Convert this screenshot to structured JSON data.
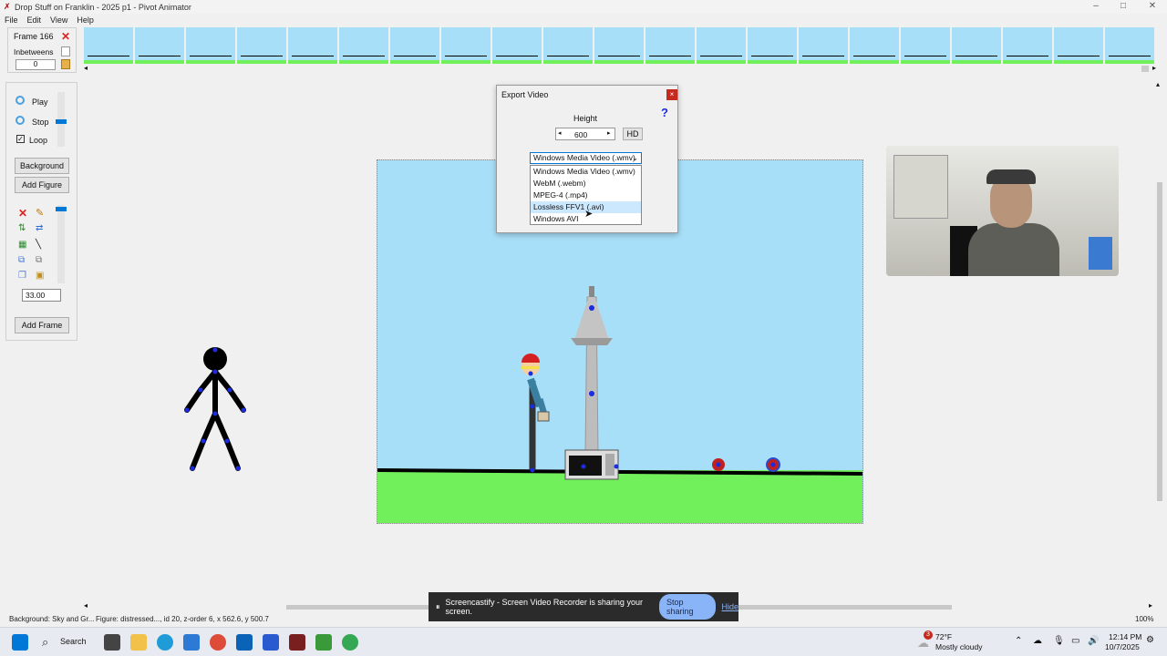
{
  "window": {
    "title": "Drop Stuff on Franklin - 2025 p1 - Pivot Animator",
    "min": "–",
    "max": "□",
    "close": "✕"
  },
  "menu": [
    "File",
    "Edit",
    "View",
    "Help"
  ],
  "frame_panel": {
    "frame_label": "Frame 166",
    "inbetweens_label": "Inbetweens",
    "inbetweens_value": "0"
  },
  "playback": {
    "play": "Play",
    "stop": "Stop",
    "loop": "Loop"
  },
  "buttons": {
    "background": "Background",
    "add_figure": "Add Figure",
    "add_frame": "Add Frame"
  },
  "scale_value": "33.00",
  "dialog": {
    "title": "Export Video",
    "help": "?",
    "height_label": "Height",
    "height_value": "600",
    "hd": "HD",
    "format_selected": "Windows Media Video (.wmv)",
    "formats": [
      "Windows Media Video (.wmv)",
      "WebM (.webm)",
      "MPEG-4 (.mp4)",
      "Lossless FFV1 (.avi)",
      "Windows AVI"
    ],
    "highlighted_index": 3
  },
  "status": {
    "background": "Background: Sky and Gr...",
    "figure": "Figure: distressed..., id 20, z-order 6, x 562.6, y 500.7",
    "zoom": "100%"
  },
  "share": {
    "text": "Screencastify - Screen Video Recorder is sharing your screen.",
    "stop": "Stop sharing",
    "hide": "Hide"
  },
  "taskbar": {
    "search": "Search",
    "weather_temp": "72°F",
    "weather_desc": "Mostly cloudy",
    "weather_badge": "3",
    "time": "12:14 PM",
    "date": "10/7/2025"
  },
  "colors": {
    "sky": "#a8dff8",
    "grass": "#72f05c",
    "accent": "#0078d7"
  }
}
